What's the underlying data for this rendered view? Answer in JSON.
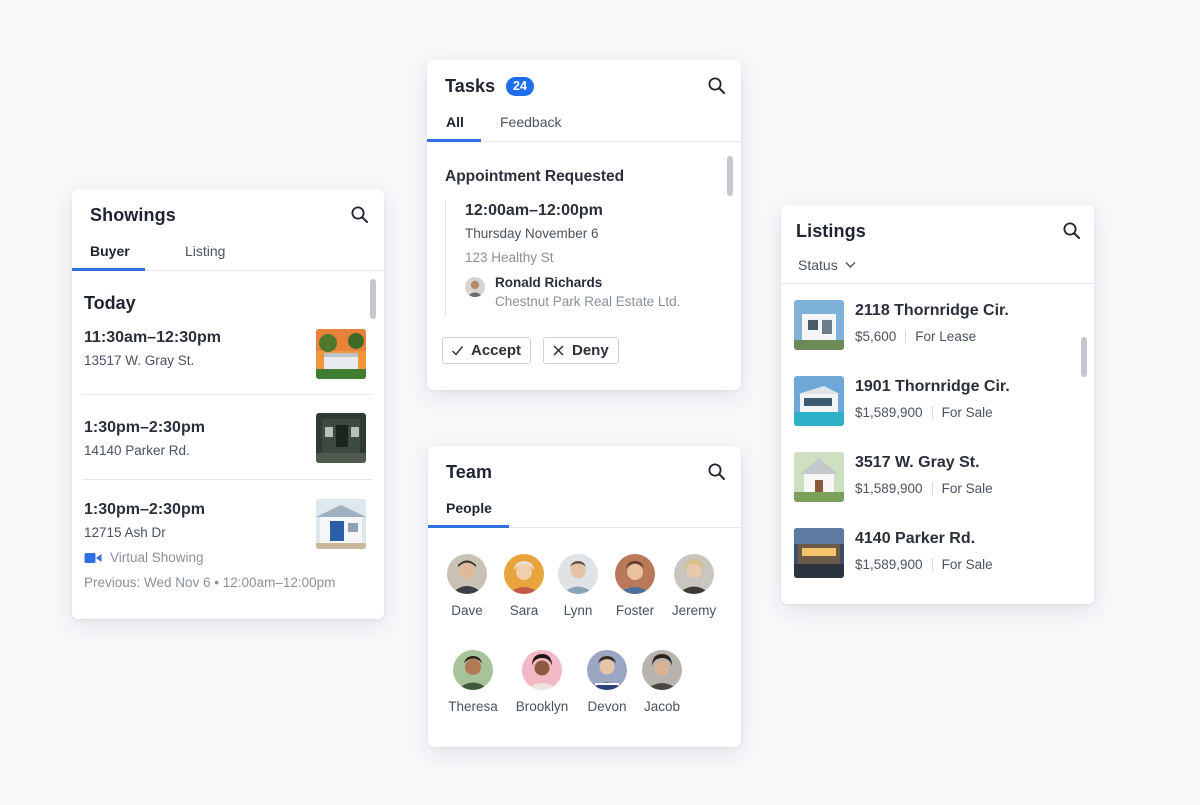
{
  "showings": {
    "title": "Showings",
    "tabs": [
      {
        "label": "Buyer",
        "active": true
      },
      {
        "label": "Listing",
        "active": false
      }
    ],
    "section": "Today",
    "items": [
      {
        "time": "11:30am–12:30pm",
        "address": "13517 W. Gray St."
      },
      {
        "time": "1:30pm–2:30pm",
        "address": "14140 Parker Rd."
      },
      {
        "time": "1:30pm–2:30pm",
        "address": "12715 Ash Dr",
        "virtual": "Virtual Showing",
        "previous": "Previous: Wed Nov 6 • 12:00am–12:00pm"
      }
    ]
  },
  "tasks": {
    "title": "Tasks",
    "count": "24",
    "tabs": [
      {
        "label": "All",
        "active": true
      },
      {
        "label": "Feedback",
        "active": false
      }
    ],
    "heading": "Appointment Requested",
    "time": "12:00am–12:00pm",
    "day": "Thursday November 6",
    "address": "123 Healthy St",
    "person": {
      "name": "Ronald Richards",
      "company": "Chestnut Park Real Estate Ltd."
    },
    "accept_label": "Accept",
    "deny_label": "Deny"
  },
  "team": {
    "title": "Team",
    "tab": "People",
    "members": [
      "Dave",
      "Sara",
      "Lynn",
      "Foster",
      "Jeremy",
      "Theresa",
      "Brooklyn",
      "Devon",
      "Jacob"
    ]
  },
  "listings": {
    "title": "Listings",
    "filter_label": "Status",
    "items": [
      {
        "address": "2118 Thornridge Cir.",
        "price": "$5,600",
        "status": "For Lease"
      },
      {
        "address": "1901 Thornridge Cir.",
        "price": "$1,589,900",
        "status": "For Sale"
      },
      {
        "address": "3517 W. Gray St.",
        "price": "$1,589,900",
        "status": "For Sale"
      },
      {
        "address": "4140 Parker Rd.",
        "price": "$1,589,900",
        "status": "For Sale"
      }
    ]
  },
  "colors": {
    "accent": "#2f6fe0",
    "badge": "#1f6feb",
    "text_primary": "#1f2430",
    "text_secondary": "#4b5260",
    "text_muted": "#8a909b"
  },
  "icons": {
    "search": "search-icon",
    "video": "video-camera-icon",
    "check": "check-icon",
    "close": "close-icon",
    "chevron": "chevron-down-icon"
  }
}
